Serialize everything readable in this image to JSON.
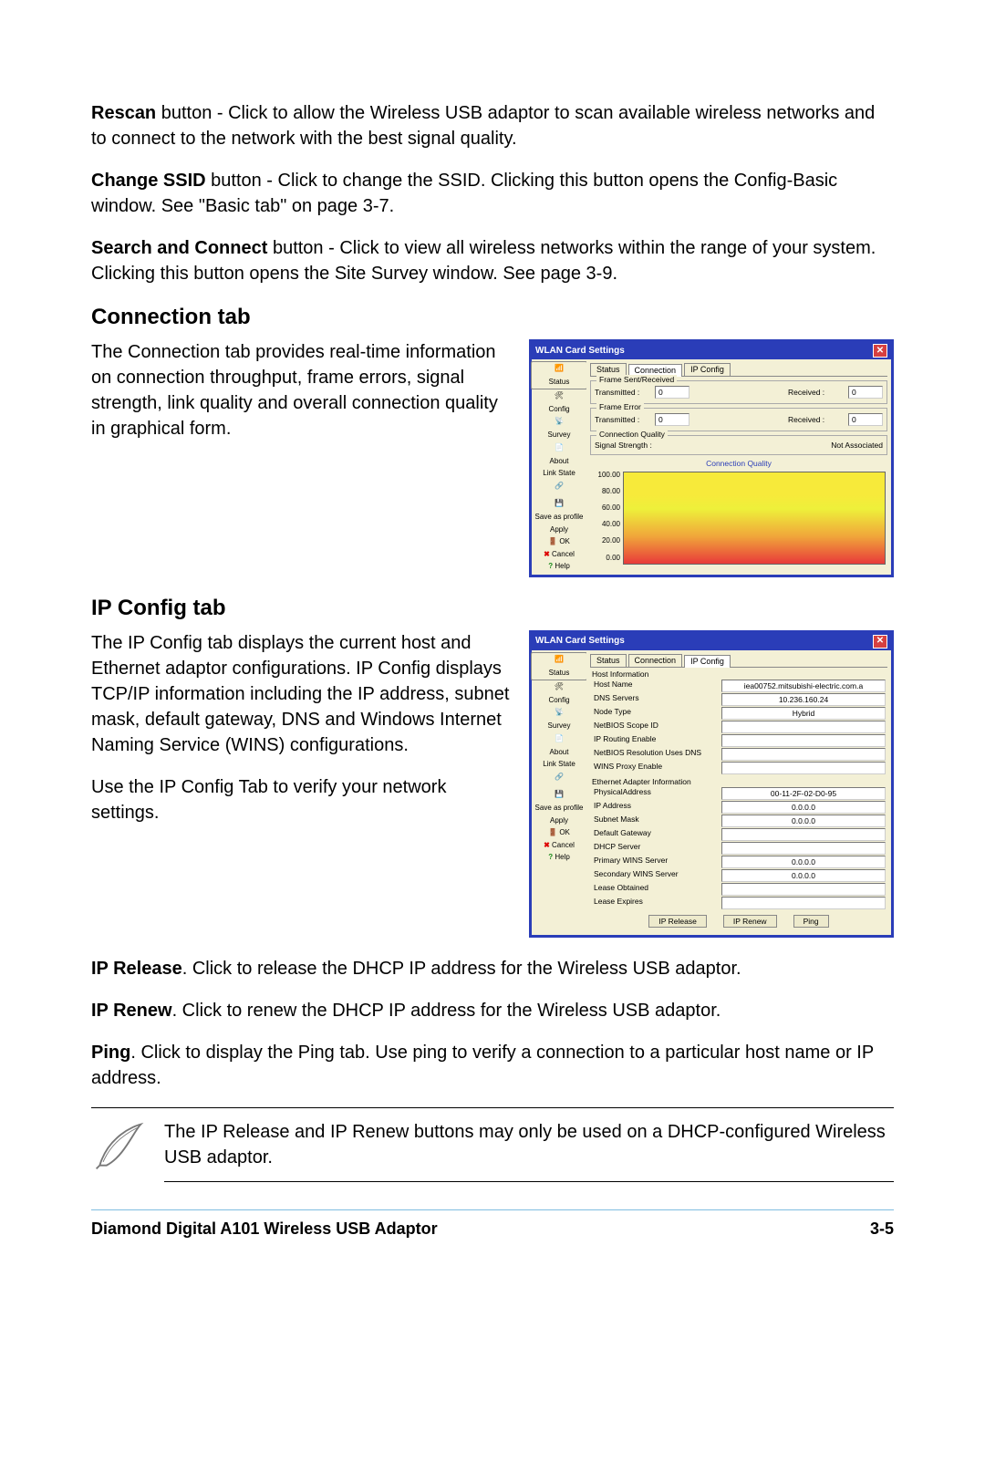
{
  "paragraphs": {
    "rescan_lead": "Rescan",
    "rescan_tail": " button - Click to allow the Wireless USB adaptor to scan available wireless networks and to connect to the network with the best signal quality.",
    "ssid_lead": "Change SSID",
    "ssid_tail": " button - Click to change the SSID. Clicking this button opens the Config-Basic window. See \"Basic tab\" on page 3-7.",
    "search_lead": "Search and Connect",
    "search_tail": " button - Click to view all wireless networks within the range of your system. Clicking this button opens the Site Survey window. See page 3-9."
  },
  "connection_section": {
    "heading": "Connection tab",
    "body": "The Connection tab provides real-time information on connection throughput, frame errors, signal strength, link quality and overall connection quality in graphical form."
  },
  "ipconfig_section": {
    "heading": "IP Config tab",
    "body1": "The IP Config tab displays the current host and Ethernet adaptor configurations. IP Config displays TCP/IP information including the IP address, subnet mask, default gateway, DNS and Windows Internet Naming Service (WINS) configurations.",
    "body2": "Use the IP Config Tab to verify your network  settings.",
    "ip_release_lead": "IP Release",
    "ip_release_tail": ". Click to release the DHCP IP address for the Wireless USB adaptor.",
    "ip_renew_lead": "IP Renew",
    "ip_renew_tail": ". Click to renew the DHCP IP address for the Wireless USB adaptor.",
    "ping_lead": "Ping",
    "ping_tail": ". Click to display the Ping  tab. Use ping to verify a connection to a particular host name or IP address."
  },
  "note": "The IP Release and IP Renew buttons may only be used on a DHCP-configured Wireless USB adaptor.",
  "footer": {
    "left": "Diamond Digital A101 Wireless USB Adaptor",
    "right": "3-5"
  },
  "wlan_window": {
    "title": "WLAN Card Settings",
    "sidebar": [
      "Status",
      "Config",
      "Survey",
      "About",
      "Link State",
      "Save as profile",
      "Apply",
      "OK",
      "Cancel",
      "Help"
    ],
    "tabs": [
      "Status",
      "Connection",
      "IP Config"
    ]
  },
  "connection_shot": {
    "frame_section": "Frame Sent/Received",
    "frame_error": "Frame Error",
    "transmitted_label": "Transmitted :",
    "received_label": "Received :",
    "transmitted_val": "0",
    "received_val": "0",
    "conn_quality_section": "Connection Quality",
    "signal_strength_label": "Signal Strength :",
    "signal_strength_val": "Not Associated",
    "chart_title": "Connection Quality"
  },
  "chart_data": {
    "type": "area",
    "title": "Connection Quality",
    "ylabel": "",
    "xlabel": "",
    "ylim": [
      0,
      100
    ],
    "y_ticks": [
      "100.00",
      "80.00",
      "60.00",
      "40.00",
      "20.00",
      "0.00"
    ],
    "series": [],
    "note": "gradient background yellow-to-red displayed with no plotted data"
  },
  "ipconfig_shot": {
    "host_info": "Host Information",
    "rows_host": [
      {
        "lbl": "Host Name",
        "val": "iea00752.mitsubishi-electric.com.a"
      },
      {
        "lbl": "DNS Servers",
        "val": "10.236.160.24"
      },
      {
        "lbl": "Node Type",
        "val": "Hybrid"
      },
      {
        "lbl": "NetBIOS Scope ID",
        "val": ""
      },
      {
        "lbl": "IP Routing Enable",
        "val": ""
      },
      {
        "lbl": "NetBIOS Resolution Uses DNS",
        "val": ""
      },
      {
        "lbl": "WINS Proxy Enable",
        "val": ""
      }
    ],
    "eth_info": "Ethernet Adapter Information",
    "rows_eth": [
      {
        "lbl": "PhysicalAddress",
        "val": "00-11-2F-02-D0-95"
      },
      {
        "lbl": "IP Address",
        "val": "0.0.0.0"
      },
      {
        "lbl": "Subnet Mask",
        "val": "0.0.0.0"
      },
      {
        "lbl": "Default Gateway",
        "val": ""
      },
      {
        "lbl": "DHCP Server",
        "val": ""
      },
      {
        "lbl": "Primary WINS Server",
        "val": "0.0.0.0"
      },
      {
        "lbl": "Secondary WINS Server",
        "val": "0.0.0.0"
      },
      {
        "lbl": "Lease Obtained",
        "val": ""
      },
      {
        "lbl": "Lease Expires",
        "val": ""
      }
    ],
    "buttons": [
      "IP Release",
      "IP Renew",
      "Ping"
    ]
  }
}
